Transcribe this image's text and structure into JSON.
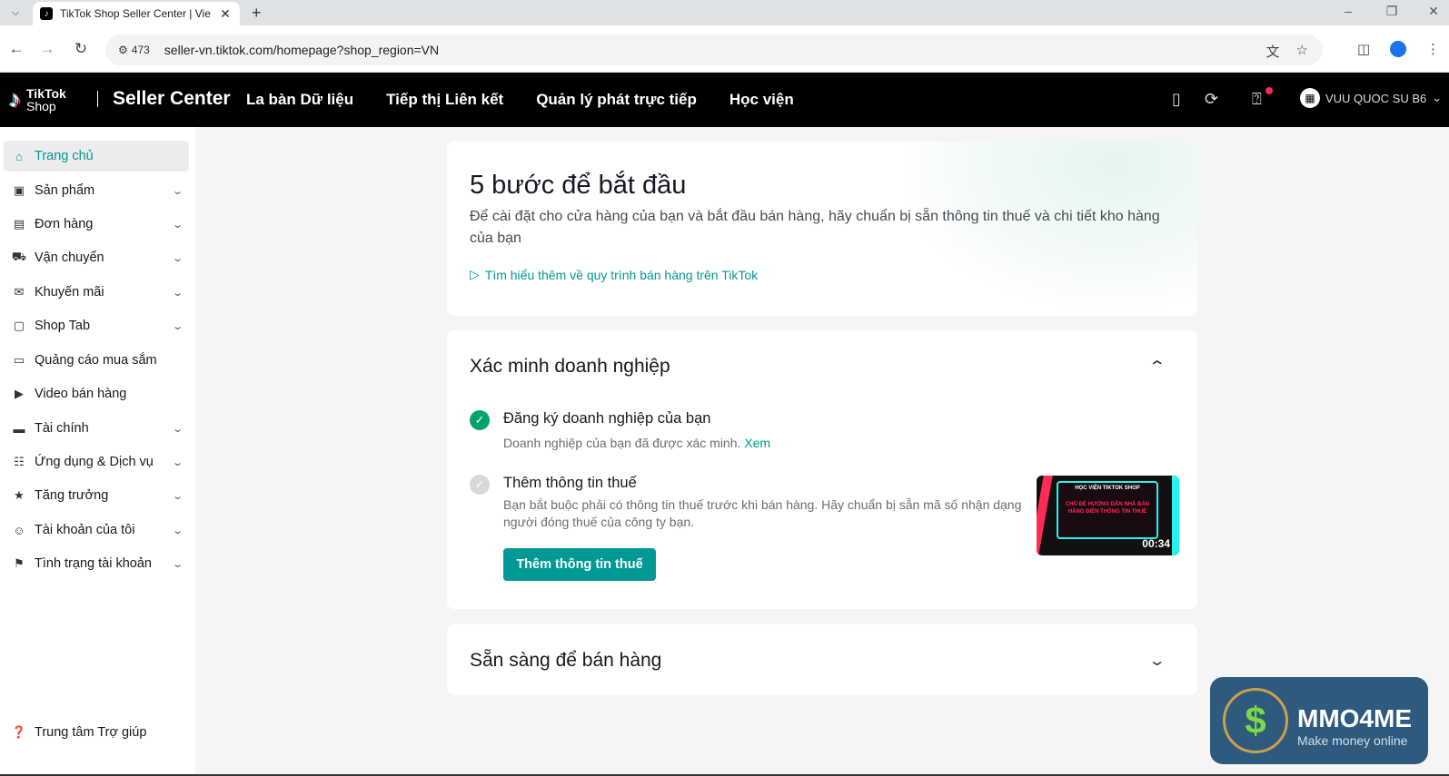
{
  "browser": {
    "tab_title": "TikTok Shop Seller Center | Vie",
    "url": "seller-vn.tiktok.com/homepage?shop_region=VN",
    "site_info_count": "473"
  },
  "header": {
    "logo_line1": "TikTok",
    "logo_line2": "Shop",
    "product_name": "Seller Center",
    "nav": [
      "La bàn Dữ liệu",
      "Tiếp thị Liên kết",
      "Quản lý phát trực tiếp",
      "Học viện"
    ],
    "user_name": "VUU QUOC SU B6"
  },
  "sidebar": {
    "items": [
      {
        "label": "Trang chủ",
        "icon": "home-icon",
        "active": true,
        "has_chevron": false
      },
      {
        "label": "Sản phẩm",
        "icon": "product-icon",
        "has_chevron": true
      },
      {
        "label": "Đơn hàng",
        "icon": "order-icon",
        "has_chevron": true
      },
      {
        "label": "Vận chuyển",
        "icon": "shipping-icon",
        "has_chevron": true
      },
      {
        "label": "Khuyến mãi",
        "icon": "megaphone-icon",
        "has_chevron": true
      },
      {
        "label": "Shop Tab",
        "icon": "shop-bag-icon",
        "has_chevron": true
      },
      {
        "label": "Quảng cáo mua sắm",
        "icon": "ads-icon",
        "has_chevron": false
      },
      {
        "label": "Video bán hàng",
        "icon": "video-icon",
        "has_chevron": false
      },
      {
        "label": "Tài chính",
        "icon": "wallet-icon",
        "has_chevron": true
      },
      {
        "label": "Ứng dụng & Dịch vụ",
        "icon": "apps-icon",
        "has_chevron": true
      },
      {
        "label": "Tăng trưởng",
        "icon": "medal-icon",
        "has_chevron": true
      },
      {
        "label": "Tài khoản của tôi",
        "icon": "user-icon",
        "has_chevron": true
      },
      {
        "label": "Tình trạng tài khoản",
        "icon": "trophy-icon",
        "has_chevron": true
      }
    ],
    "help_label": "Trung tâm Trợ giúp"
  },
  "intro": {
    "title": "5 bước để bắt đầu",
    "description": "Để cài đặt cho cửa hàng của bạn và bắt đầu bán hàng, hãy chuẩn bị sẵn thông tin thuế và chi tiết kho hàng của bạn",
    "learn_more": "Tìm hiểu thêm về quy trình bán hàng trên TikTok"
  },
  "verification": {
    "title": "Xác minh doanh nghiệp",
    "step1": {
      "title": "Đăng ký doanh nghiệp của bạn",
      "subtitle": "Doanh nghiệp của bạn đã được xác minh.",
      "link": "Xem"
    },
    "step2": {
      "title": "Thêm thông tin thuế",
      "subtitle": "Bạn bắt buộc phải có thông tin thuế trước khi bán hàng. Hãy chuẩn bị sẵn mã số nhận dạng người đóng thuế của công ty bạn.",
      "button": "Thêm thông tin thuế"
    },
    "video": {
      "caption_top": "HỌC VIỆN TIKTOK SHOP",
      "caption_main": "CHỦ ĐỀ HƯỚNG DẪN NHÀ BÁN HÀNG ĐIỀN THÔNG TIN THUẾ",
      "duration": "00:34"
    }
  },
  "ready": {
    "title": "Sẵn sàng để bán hàng"
  },
  "watermark": {
    "title": "MMO4ME",
    "subtitle": "Make money online"
  },
  "colors": {
    "accent": "#009995",
    "success": "#00a36d",
    "header_bg": "#000000"
  }
}
